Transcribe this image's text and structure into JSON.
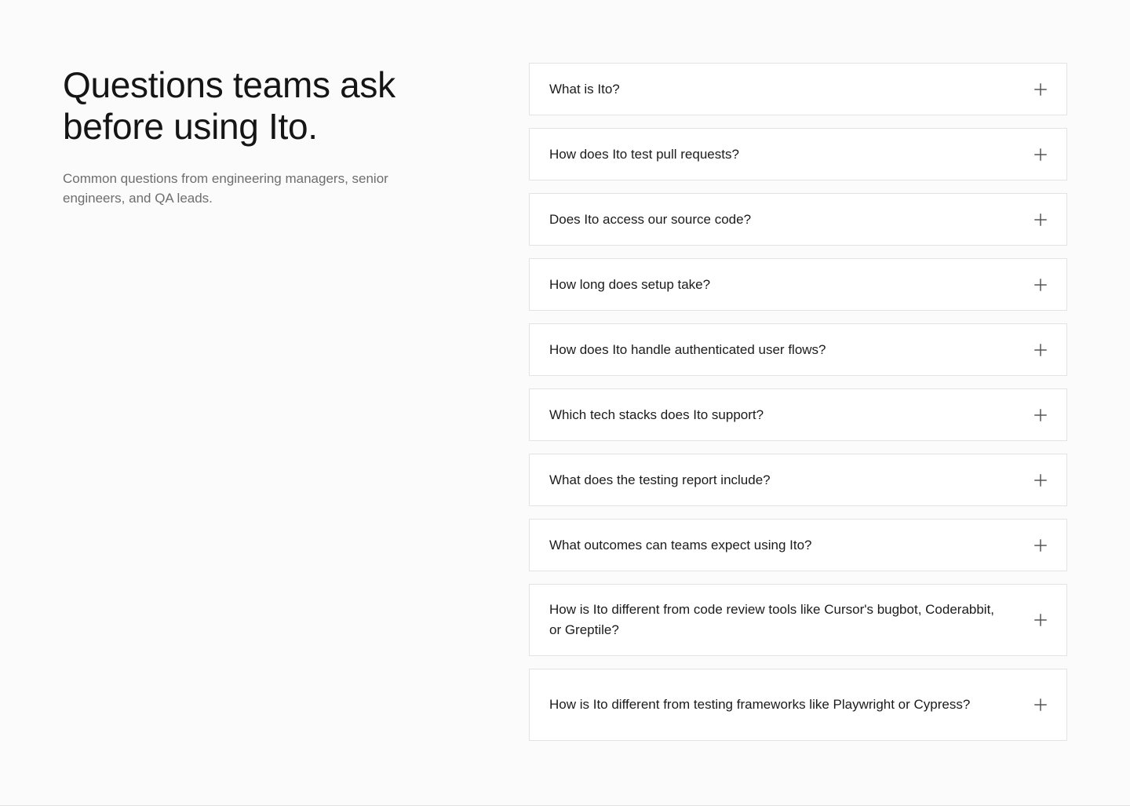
{
  "intro": {
    "title_line1": "Questions teams ask",
    "title_line2": "before using Ito.",
    "subtitle": "Common questions from engineering managers, senior engineers, and QA leads."
  },
  "faq": [
    {
      "question": "What is Ito?",
      "icon": "plus-icon"
    },
    {
      "question": "How does Ito test pull requests?",
      "icon": "plus-icon"
    },
    {
      "question": "Does Ito access our source code?",
      "icon": "plus-icon"
    },
    {
      "question": "How long does setup take?",
      "icon": "plus-icon"
    },
    {
      "question": "How does Ito handle authenticated user flows?",
      "icon": "plus-icon"
    },
    {
      "question": "Which tech stacks does Ito support?",
      "icon": "plus-icon"
    },
    {
      "question": "What does the testing report include?",
      "icon": "plus-icon"
    },
    {
      "question": "What outcomes can teams expect using Ito?",
      "icon": "plus-icon"
    },
    {
      "question": "How is Ito different from code review tools like Cursor's bugbot, Coderabbit, or Greptile?",
      "icon": "plus-icon"
    },
    {
      "question": "How is Ito different from testing frameworks like Playwright or Cypress?",
      "icon": "plus-icon"
    }
  ]
}
